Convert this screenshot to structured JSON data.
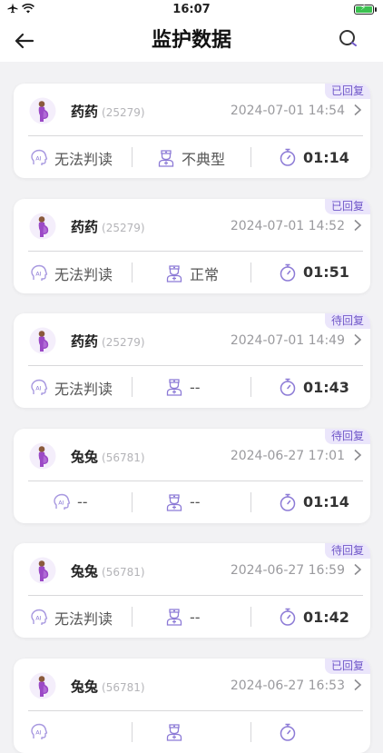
{
  "status": {
    "time": "16:07"
  },
  "header": {
    "title": "监护数据"
  },
  "records": [
    {
      "name": "药药",
      "uid": "(25279)",
      "time": "2024-07-01 14:54",
      "badge": "已回复",
      "ai": "无法判读",
      "doctor": "不典型",
      "duration": "01:14"
    },
    {
      "name": "药药",
      "uid": "(25279)",
      "time": "2024-07-01 14:52",
      "badge": "已回复",
      "ai": "无法判读",
      "doctor": "正常",
      "duration": "01:51"
    },
    {
      "name": "药药",
      "uid": "(25279)",
      "time": "2024-07-01 14:49",
      "badge": "待回复",
      "ai": "无法判读",
      "doctor": "--",
      "duration": "01:43"
    },
    {
      "name": "兔兔",
      "uid": "(56781)",
      "time": "2024-06-27 17:01",
      "badge": "待回复",
      "ai": "--",
      "doctor": "--",
      "duration": "01:14"
    },
    {
      "name": "兔兔",
      "uid": "(56781)",
      "time": "2024-06-27 16:59",
      "badge": "待回复",
      "ai": "无法判读",
      "doctor": "--",
      "duration": "01:42"
    },
    {
      "name": "兔兔",
      "uid": "(56781)",
      "time": "2024-06-27 16:53",
      "badge": "已回复",
      "ai": "",
      "doctor": "",
      "duration": ""
    }
  ]
}
